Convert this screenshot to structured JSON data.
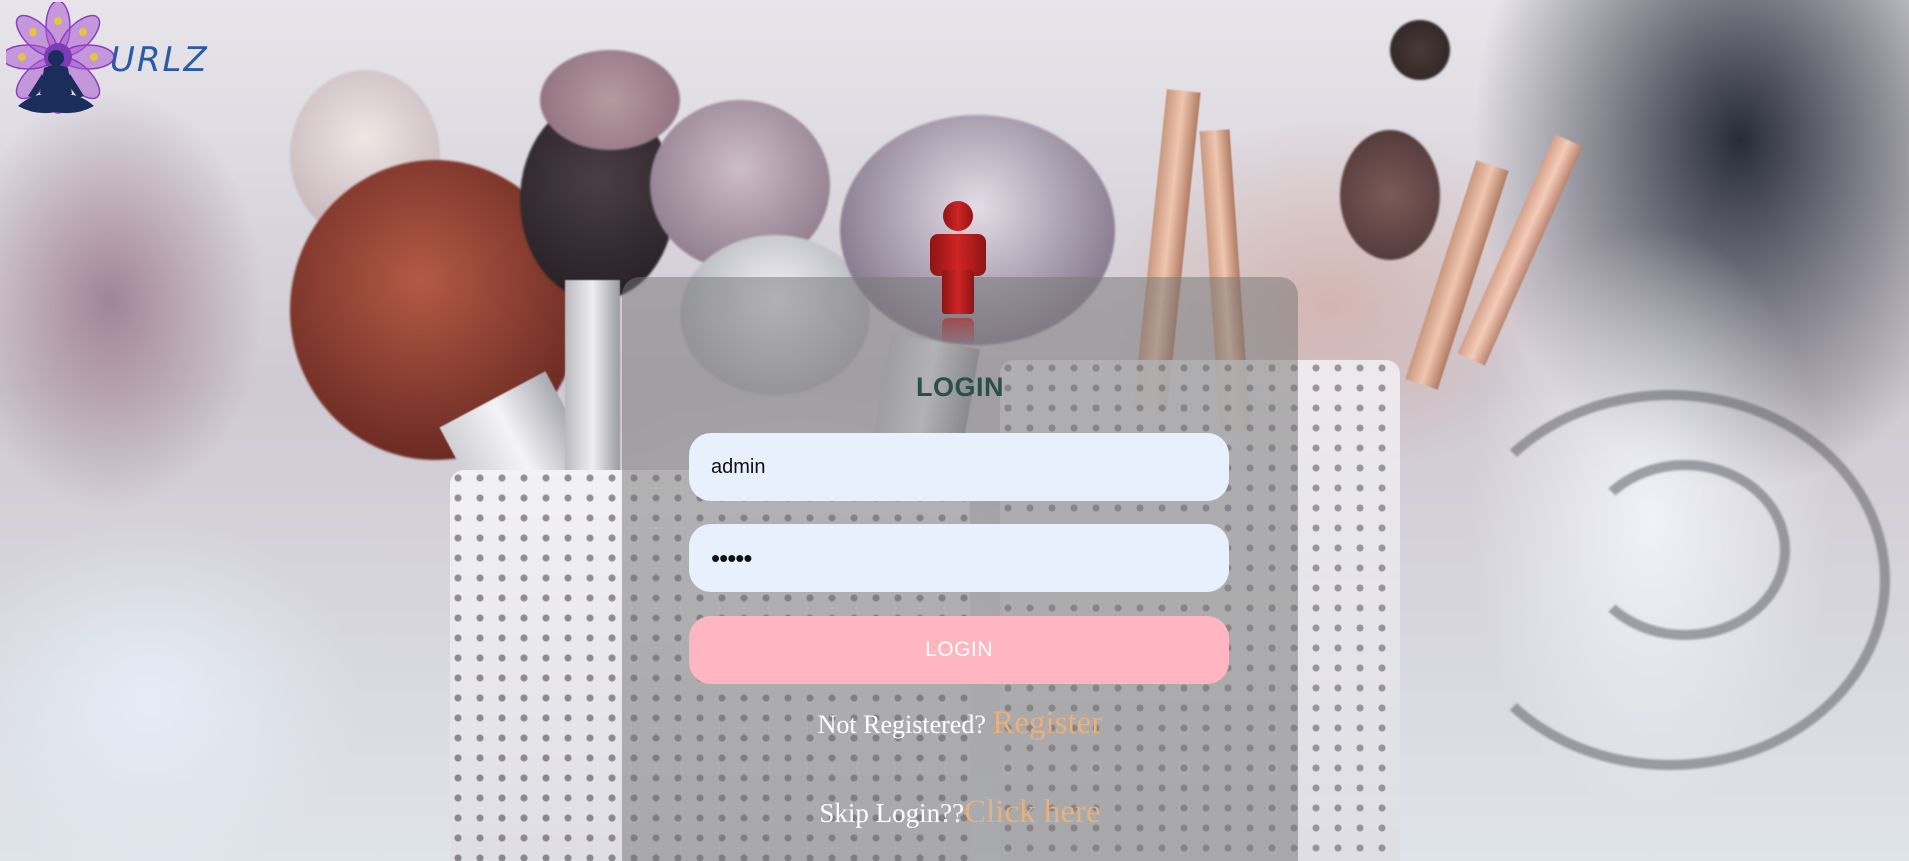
{
  "logo": {
    "text": "URLZ",
    "icon": "lotus-meditation-logo"
  },
  "login_form": {
    "icon": "user-icon",
    "title": "LOGIN",
    "username_value": "admin",
    "password_masked": "•••••",
    "submit_label": "LOGIN",
    "register_prompt": "Not Registered?",
    "register_link": "Register",
    "skip_prompt": "Skip Login??",
    "skip_link": "Click here"
  },
  "colors": {
    "title": "#2a4f4a",
    "button": "#ffb6c1",
    "link": "#e8b07a",
    "field_bg": "#e8f0fe",
    "user_icon": "#b71c1c"
  }
}
